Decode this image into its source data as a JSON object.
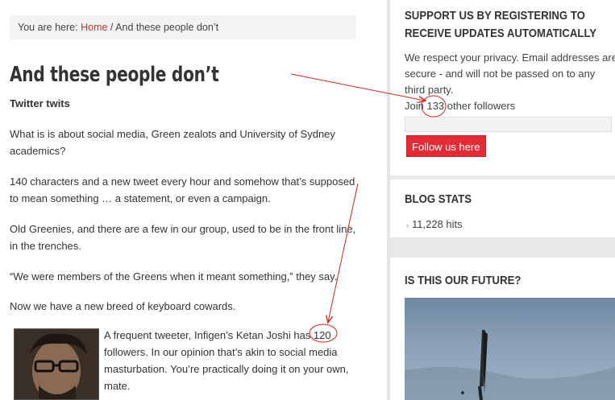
{
  "breadcrumb": {
    "prefix": "You are here:",
    "home": "Home",
    "separator": " / ",
    "current": "And these people don’t"
  },
  "post": {
    "title": "And these people don’t",
    "subtitle": "Twitter twits",
    "paragraphs": [
      "What is is about social media, Green zealots and University of Sydney academics?",
      "140 characters and a new tweet every hour and somehow that’s supposed to mean something … a statement, or even a campaign.",
      "Old Greenies, and there are a few in our group, used to be in the front line, in the trenches.",
      "“We were members of the Greens when it meant something,” they say.",
      "Now we have a new breed of keyboard cowards."
    ],
    "photo_paragraph": "A frequent tweeter, Infigen’s Ketan Joshi has 120 followers.  In our opinion that’s akin to social media masturbation. You’re practically doing it on your own, mate."
  },
  "sidebar": {
    "register": {
      "title": "Support us by registering to receive updates automatically",
      "privacy": "We respect your privacy. Email addresses are secure - and will not be passed on to any third party.",
      "join_text": "Join 133 other followers",
      "email_placeholder": "",
      "button": "Follow us here"
    },
    "stats": {
      "title": "Blog Stats",
      "hits": "11,228 hits"
    },
    "future": {
      "title": "Is this our future?"
    }
  },
  "colors": {
    "link": "#c9302c",
    "button": "#e32b35",
    "annotation": "#d42020"
  }
}
